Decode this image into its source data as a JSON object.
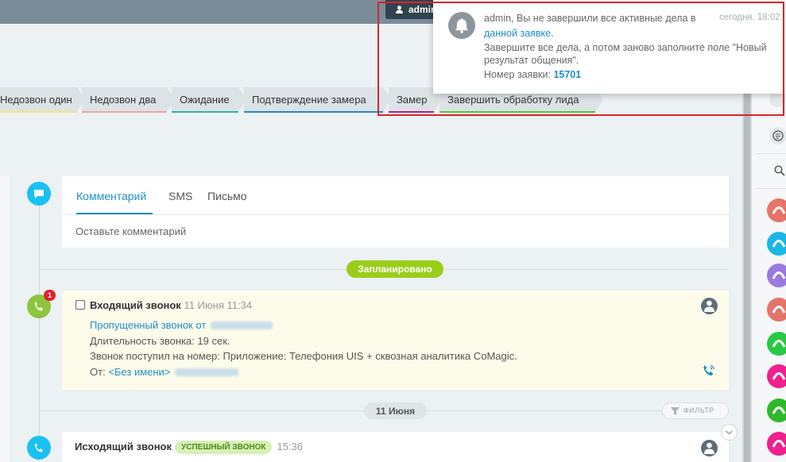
{
  "header": {
    "user_label": "admin"
  },
  "stages": [
    {
      "label": "Недозвон один",
      "color": "#f5e37a"
    },
    {
      "label": "Недозвон два",
      "color": "#f4a5a0"
    },
    {
      "label": "Ожидание",
      "color": "#2bb7a5"
    },
    {
      "label": "Подтверждение замера",
      "color": "#2a86c2"
    },
    {
      "label": "Замер",
      "color": "#a3288c"
    },
    {
      "label": "Завершить обработку лида",
      "color": "#5ac43f"
    }
  ],
  "composer": {
    "tabs": [
      "Комментарий",
      "SMS",
      "Письмо"
    ],
    "active_tab": "Комментарий",
    "placeholder": "Оставьте комментарий"
  },
  "planned_label": "Запланировано",
  "incoming_call": {
    "badge_count": "1",
    "title": "Входящий звонок",
    "date": "11 Июня 11:34",
    "missed_text": "Пропущенный звонок от",
    "duration": "Длительность звонка: 19 сек.",
    "number_line": "Звонок поступил на номер: Приложение: Телефония UIS + сквозная аналитика CoMagic.",
    "from_label": "От:",
    "from_name": "<Без имени>"
  },
  "date_divider": "11 Июня",
  "filter_label": "ФИЛЬТР",
  "outgoing_call": {
    "title": "Исходящий звонок",
    "status_badge": "УСПЕШНЫЙ ЗВОНОК",
    "time": "15:36"
  },
  "notification": {
    "line1": "admin, Вы не завершили все активные дела в",
    "time": "сегодня, 18:02",
    "link_text": "данной заявке",
    "link_suffix": ".",
    "line3": "Завершите все дела, а потом заново заполните поле \"Новый",
    "line4": "результат общения\".",
    "request_label": "Номер заявки:",
    "request_number": "15701"
  },
  "side_avatars": [
    "#e57368",
    "#1ab7e6",
    "#9b7ae0",
    "#e57368",
    "#2ac944",
    "#f0208e",
    "#2fb92a",
    "#f0208e"
  ],
  "colors": {
    "accent": "#1e8fc6",
    "planned": "#9acd1a",
    "incoming_dot": "#8cc63f",
    "timeline_dot": "#19c1f2"
  }
}
